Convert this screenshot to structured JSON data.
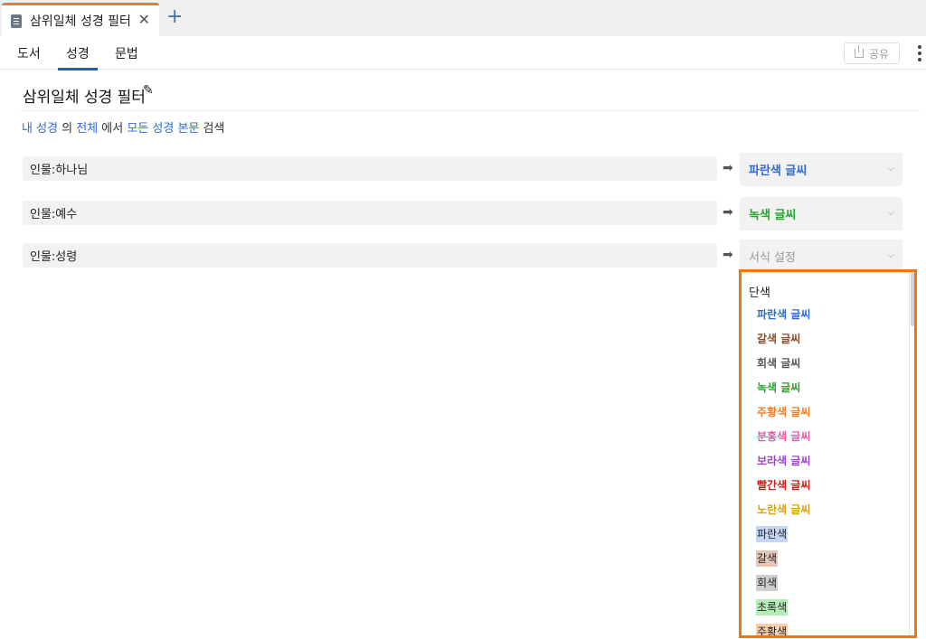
{
  "tab": {
    "title": "삼위일체 성경 필터",
    "close": "✕",
    "new": "+"
  },
  "menu": {
    "items": [
      "도서",
      "성경",
      "문법"
    ],
    "active": 1,
    "share": "공유"
  },
  "page": {
    "title": "삼위일체 성경 필터",
    "edit_icon": "pencil-icon"
  },
  "scope": {
    "w1": "내 성경",
    "w2": " 의 ",
    "w3": "전체",
    "w4": " 에서 ",
    "w5": "모든 성경 본문",
    "w6": " 검색"
  },
  "filters": [
    {
      "query": "인물:하나님",
      "format": "파란색 글씨",
      "format_color": "#2d6bd1"
    },
    {
      "query": "인물:예수",
      "format": "녹색 글씨",
      "format_color": "#22a52a"
    },
    {
      "query": "인물:성령",
      "format": "서식 설정",
      "format_color": "#9a9a9a"
    }
  ],
  "dropdown": {
    "group": "단색",
    "options": [
      {
        "label": "파란색 글씨",
        "color": "#2d6bd1",
        "bg": ""
      },
      {
        "label": "갈색 글씨",
        "color": "#8a4a25",
        "bg": ""
      },
      {
        "label": "회색 글씨",
        "color": "#555555",
        "bg": ""
      },
      {
        "label": "녹색 글씨",
        "color": "#22a52a",
        "bg": ""
      },
      {
        "label": "주황색 글씨",
        "color": "#ef7d22",
        "bg": ""
      },
      {
        "label": "분홍색 글씨",
        "color": "#e85aa8",
        "bg": ""
      },
      {
        "label": "보라색 글씨",
        "color": "#9b45c9",
        "bg": ""
      },
      {
        "label": "빨간색 글씨",
        "color": "#d11a1a",
        "bg": ""
      },
      {
        "label": "노란색 글씨",
        "color": "#d9a300",
        "bg": ""
      },
      {
        "label": "파란색",
        "color": "#222222",
        "bg": "#c4d6f5"
      },
      {
        "label": "갈색",
        "color": "#222222",
        "bg": "#e3c8b8"
      },
      {
        "label": "회색",
        "color": "#222222",
        "bg": "#cfcfcf"
      },
      {
        "label": "초록색",
        "color": "#222222",
        "bg": "#b5ebb5"
      },
      {
        "label": "주황색",
        "color": "#222222",
        "bg": "#f8cfa8"
      }
    ]
  }
}
